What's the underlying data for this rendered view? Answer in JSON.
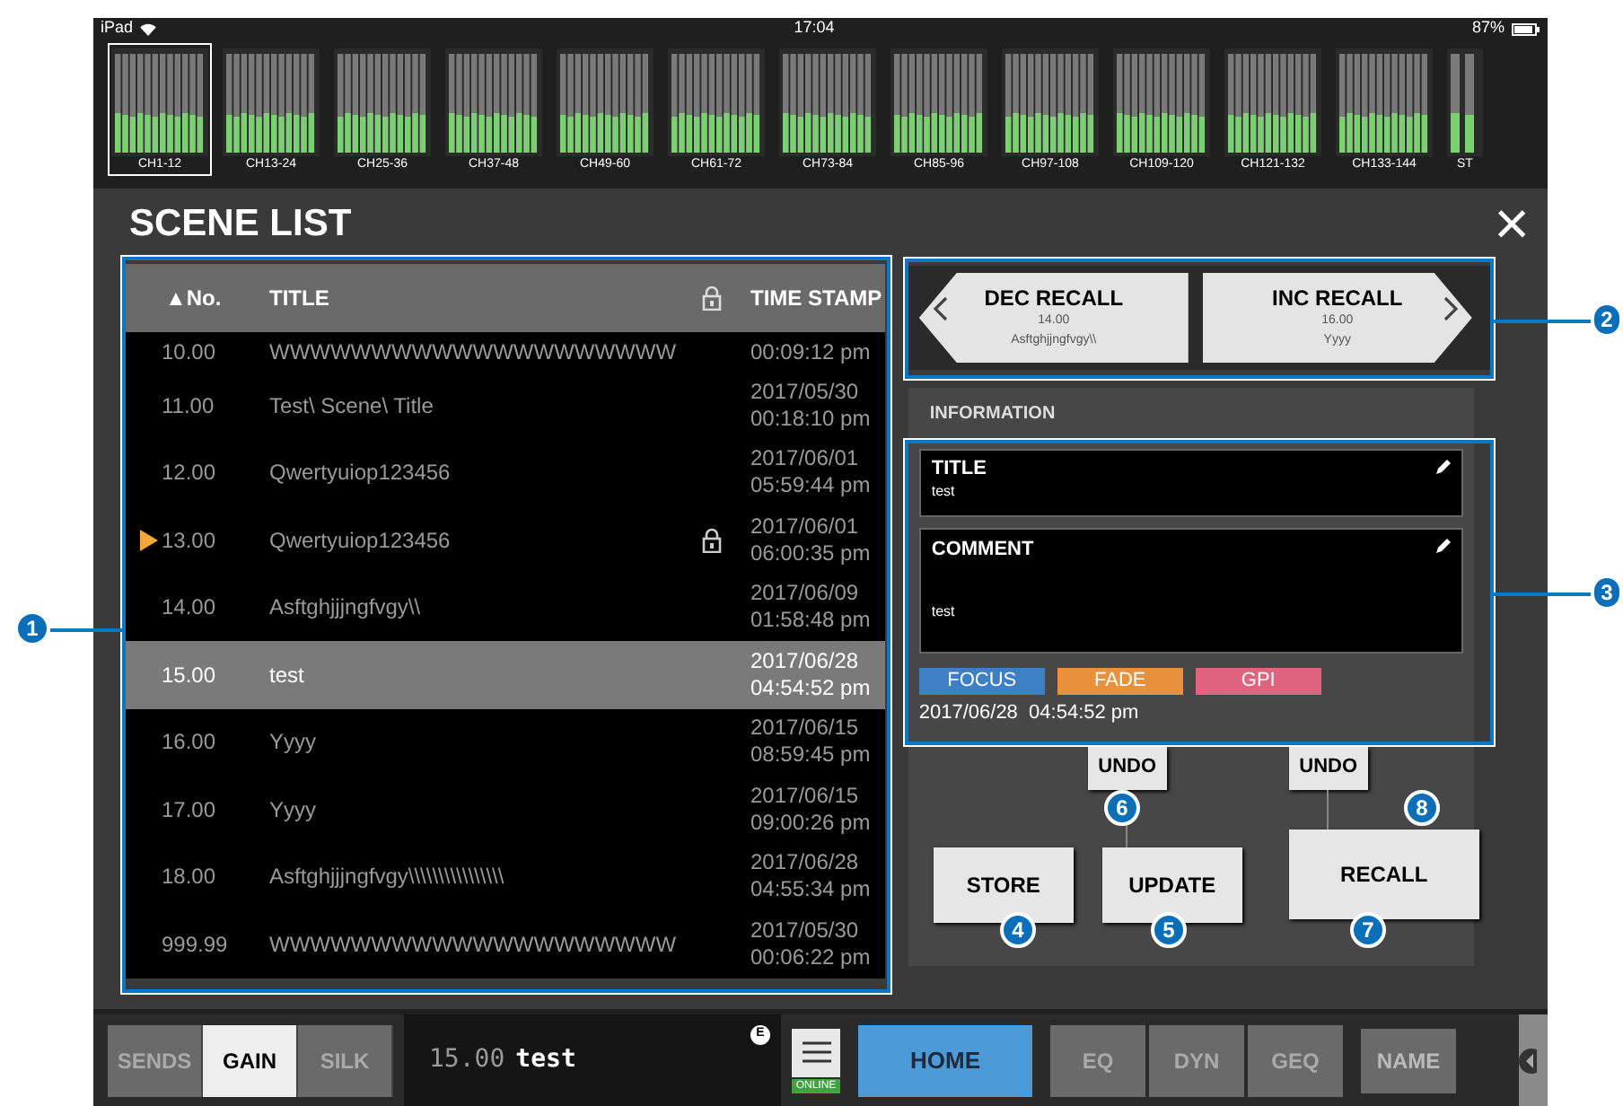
{
  "status_bar": {
    "device": "iPad",
    "time": "17:04",
    "battery": "87%"
  },
  "channel_groups": [
    {
      "label": "CH1-12",
      "selected": true
    },
    {
      "label": "CH13-24",
      "selected": false
    },
    {
      "label": "CH25-36",
      "selected": false
    },
    {
      "label": "CH37-48",
      "selected": false
    },
    {
      "label": "CH49-60",
      "selected": false
    },
    {
      "label": "CH61-72",
      "selected": false
    },
    {
      "label": "CH73-84",
      "selected": false
    },
    {
      "label": "CH85-96",
      "selected": false
    },
    {
      "label": "CH97-108",
      "selected": false
    },
    {
      "label": "CH109-120",
      "selected": false
    },
    {
      "label": "CH121-132",
      "selected": false
    },
    {
      "label": "CH133-144",
      "selected": false
    },
    {
      "label": "ST",
      "selected": false
    }
  ],
  "dialog": {
    "title": "SCENE LIST",
    "close": "×"
  },
  "table": {
    "columns": [
      "▲No.",
      "TITLE",
      "TIME STAMP"
    ],
    "rows": [
      {
        "no": "10.00",
        "title": "WWWWWWWWWWWWWWWWWWWW",
        "date": "",
        "time": "00:09:12 pm",
        "locked": false,
        "current": false,
        "selected": false
      },
      {
        "no": "11.00",
        "title": "Test\\ Scene\\ Title",
        "date": "2017/05/30",
        "time": "00:18:10 pm",
        "locked": false,
        "current": false,
        "selected": false
      },
      {
        "no": "12.00",
        "title": "Qwertyuiop123456",
        "date": "2017/06/01",
        "time": "05:59:44 pm",
        "locked": false,
        "current": false,
        "selected": false
      },
      {
        "no": "13.00",
        "title": "Qwertyuiop123456",
        "date": "2017/06/01",
        "time": "06:00:35 pm",
        "locked": true,
        "current": true,
        "selected": false
      },
      {
        "no": "14.00",
        "title": "Asftghjjjngfvgy\\\\",
        "date": "2017/06/09",
        "time": "01:58:48 pm",
        "locked": false,
        "current": false,
        "selected": false
      },
      {
        "no": "15.00",
        "title": "test",
        "date": "2017/06/28",
        "time": "04:54:52 pm",
        "locked": false,
        "current": false,
        "selected": true
      },
      {
        "no": "16.00",
        "title": "Yyyy",
        "date": "2017/06/15",
        "time": "08:59:45 pm",
        "locked": false,
        "current": false,
        "selected": false
      },
      {
        "no": "17.00",
        "title": "Yyyy",
        "date": "2017/06/15",
        "time": "09:00:26 pm",
        "locked": false,
        "current": false,
        "selected": false
      },
      {
        "no": "18.00",
        "title": "Asftghjjjngfvgy\\\\\\\\\\\\\\\\\\\\\\\\\\\\\\\\",
        "date": "2017/06/28",
        "time": "04:55:34 pm",
        "locked": false,
        "current": false,
        "selected": false
      },
      {
        "no": "999.99",
        "title": "WWWWWWWWWWWWWWWWWWWW",
        "date": "2017/05/30",
        "time": "00:06:22 pm",
        "locked": false,
        "current": false,
        "selected": false
      }
    ]
  },
  "recall": {
    "dec": {
      "label": "DEC RECALL",
      "no": "14.00",
      "title": "Asftghjjngfvgy\\\\"
    },
    "inc": {
      "label": "INC RECALL",
      "no": "16.00",
      "title": "Yyyy"
    }
  },
  "information": {
    "heading": "INFORMATION",
    "title_label": "TITLE",
    "title": "test",
    "comment_label": "COMMENT",
    "comment": "test",
    "tags": [
      {
        "label": "FOCUS",
        "color": "#3d80c6"
      },
      {
        "label": "FADE",
        "color": "#e8913c"
      },
      {
        "label": "GPI",
        "color": "#e0637f"
      }
    ],
    "timestamp": "2017/06/28  04:54:52 pm"
  },
  "actions": {
    "store": "STORE",
    "update": "UPDATE",
    "update_undo": "UNDO",
    "recall": "RECALL",
    "recall_undo": "UNDO"
  },
  "bottom_bar": {
    "tabs": [
      {
        "label": "SENDS",
        "selected": false
      },
      {
        "label": "GAIN",
        "selected": true
      },
      {
        "label": "SILK",
        "selected": false
      }
    ],
    "scene_no": "15.00",
    "scene_title": "test",
    "edit_mark": "E",
    "online": "ONLINE",
    "home": "HOME",
    "buttons": [
      "EQ",
      "DYN",
      "GEQ"
    ],
    "name": "NAME"
  },
  "callouts": [
    "1",
    "2",
    "3",
    "4",
    "5",
    "6",
    "7",
    "8"
  ]
}
